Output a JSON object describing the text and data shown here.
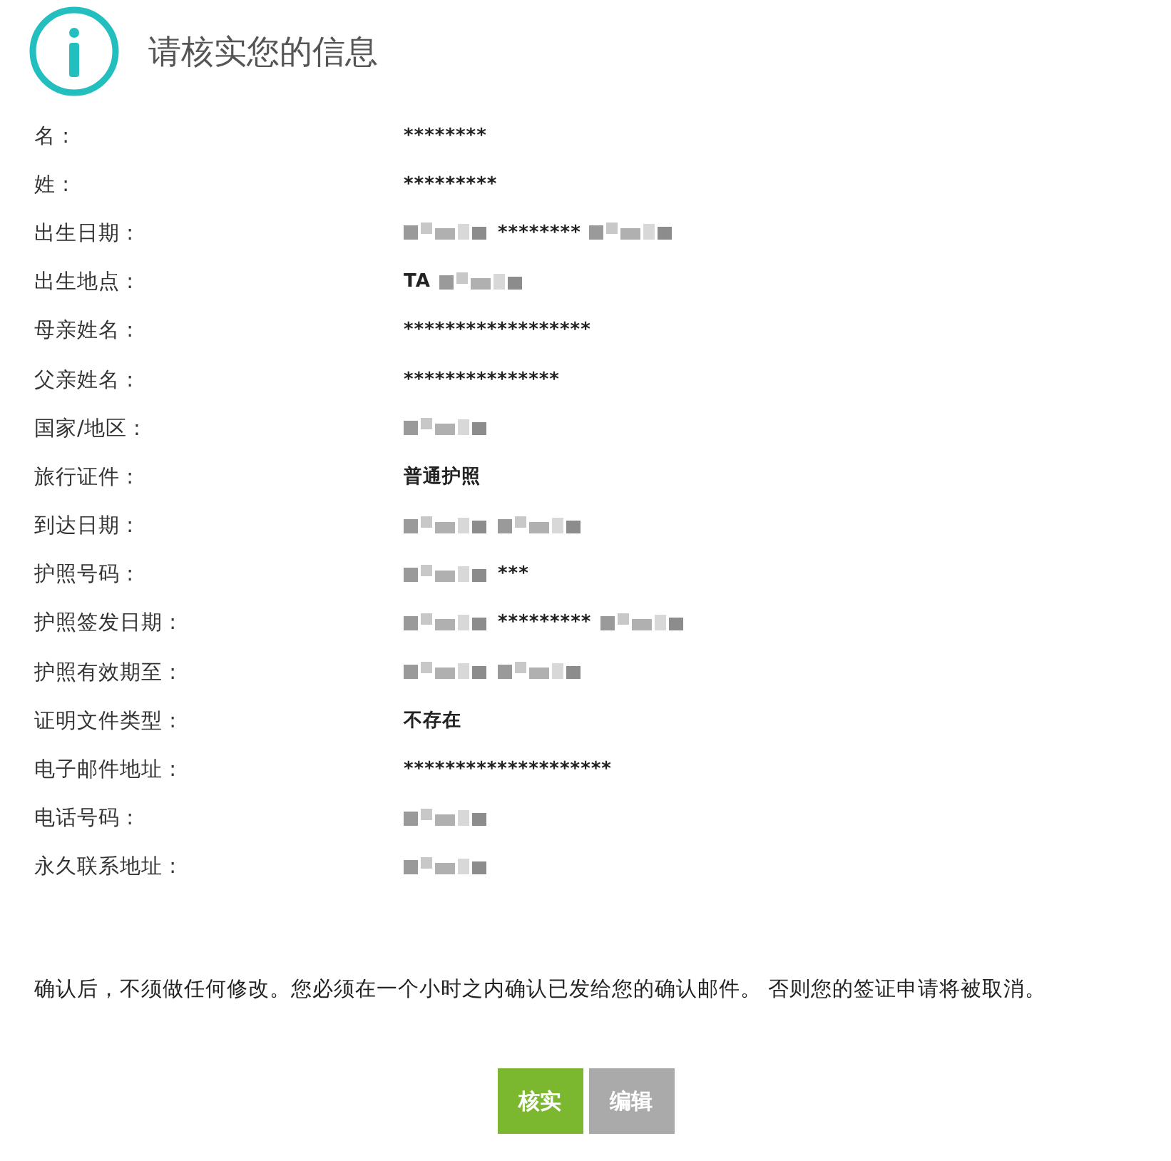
{
  "header": {
    "title": "请核实您的信息"
  },
  "fields": [
    {
      "label": "名 :",
      "value": [
        {
          "kind": "text",
          "text": "********"
        }
      ]
    },
    {
      "label": "姓 :",
      "value": [
        {
          "kind": "text",
          "text": "*********"
        }
      ]
    },
    {
      "label": "出生日期 :",
      "value": [
        {
          "kind": "blur"
        },
        {
          "kind": "text",
          "text": "********"
        },
        {
          "kind": "blur"
        }
      ]
    },
    {
      "label": "出生地点 :",
      "value": [
        {
          "kind": "text",
          "text": "TA"
        },
        {
          "kind": "blur"
        }
      ]
    },
    {
      "label": "母亲姓名 :",
      "value": [
        {
          "kind": "text",
          "text": "******************"
        }
      ]
    },
    {
      "label": "父亲姓名 :",
      "value": [
        {
          "kind": "text",
          "text": "***************"
        }
      ]
    },
    {
      "label": "国家/地区 :",
      "value": [
        {
          "kind": "blur"
        }
      ]
    },
    {
      "label": "旅行证件 :",
      "value": [
        {
          "kind": "text",
          "text": "普通护照"
        }
      ]
    },
    {
      "label": "到达日期 :",
      "value": [
        {
          "kind": "blur"
        },
        {
          "kind": "blur"
        }
      ]
    },
    {
      "label": "护照号码 :",
      "value": [
        {
          "kind": "blur"
        },
        {
          "kind": "text",
          "text": "***"
        }
      ]
    },
    {
      "label": "护照签发日期 :",
      "value": [
        {
          "kind": "blur"
        },
        {
          "kind": "text",
          "text": "*********"
        },
        {
          "kind": "blur"
        }
      ]
    },
    {
      "label": "护照有效期至 :",
      "value": [
        {
          "kind": "blur"
        },
        {
          "kind": "blur"
        }
      ]
    },
    {
      "label": "证明文件类型 :",
      "value": [
        {
          "kind": "text",
          "text": "不存在"
        }
      ]
    },
    {
      "label": "电子邮件地址 :",
      "value": [
        {
          "kind": "text",
          "text": "********************"
        }
      ]
    },
    {
      "label": "电话号码 :",
      "value": [
        {
          "kind": "blur"
        }
      ]
    },
    {
      "label": "永久联系地址 :",
      "value": [
        {
          "kind": "blur"
        }
      ]
    }
  ],
  "notice": "确认后，不须做任何修改。您必须在一个小时之内确认已发给您的确认邮件。 否则您的签证申请将被取消。",
  "buttons": [
    {
      "label": "核实",
      "kind": "primary"
    },
    {
      "label": "编辑",
      "kind": "secondary"
    }
  ]
}
